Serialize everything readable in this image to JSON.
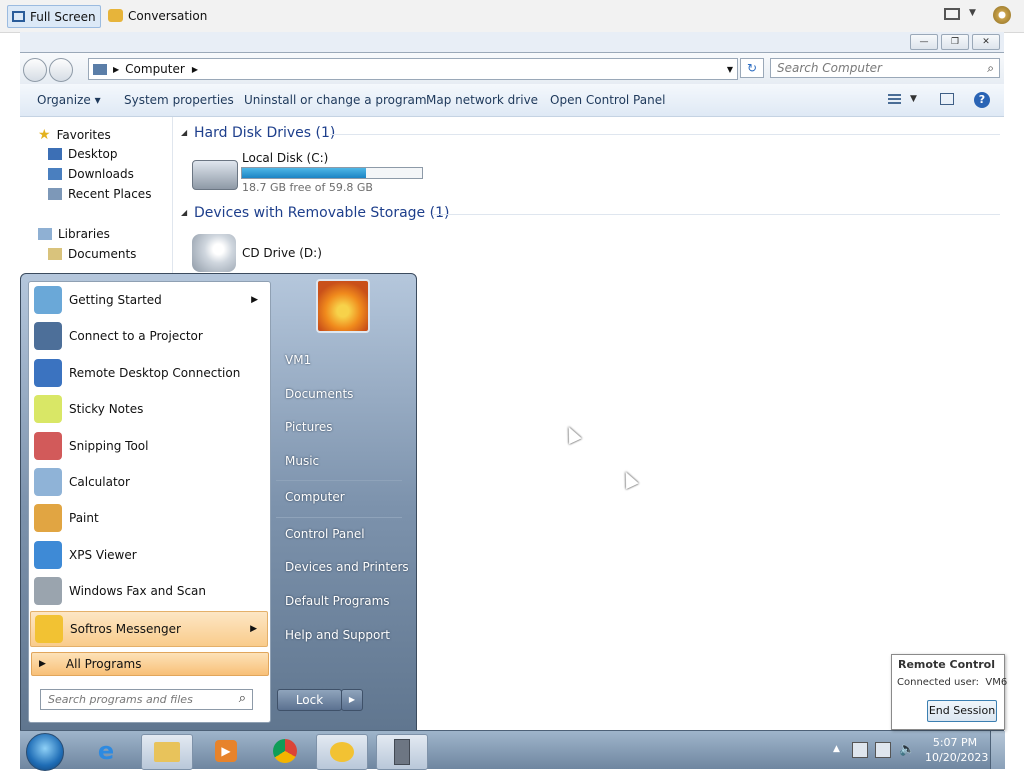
{
  "viewer": {
    "fullscreen_label": "Full Screen",
    "conversation_label": "Conversation"
  },
  "explorer": {
    "address_crumb": "Computer",
    "search_placeholder": "Search Computer",
    "commands": [
      "Organize",
      "System properties",
      "Uninstall or change a program",
      "Map network drive",
      "Open Control Panel"
    ],
    "nav_pane": {
      "favorites_label": "Favorites",
      "favorites": [
        "Desktop",
        "Downloads",
        "Recent Places"
      ],
      "libraries_label": "Libraries",
      "libraries": [
        "Documents"
      ]
    },
    "groups": {
      "hard_disk_header": "Hard Disk Drives (1)",
      "removable_header": "Devices with Removable Storage (1)"
    },
    "local_disk": {
      "name": "Local Disk (C:)",
      "free_text": "18.7 GB free of 59.8 GB",
      "used_fraction": 0.69
    },
    "cd_drive": {
      "name": "CD Drive (D:)"
    }
  },
  "start_menu": {
    "programs": [
      {
        "label": "Getting Started",
        "icon": "getting-started-icon",
        "submenu": true
      },
      {
        "label": "Connect to a Projector",
        "icon": "projector-icon",
        "submenu": false
      },
      {
        "label": "Remote Desktop Connection",
        "icon": "remote-desktop-icon",
        "submenu": false
      },
      {
        "label": "Sticky Notes",
        "icon": "sticky-notes-icon",
        "submenu": false
      },
      {
        "label": "Snipping Tool",
        "icon": "snipping-tool-icon",
        "submenu": false
      },
      {
        "label": "Calculator",
        "icon": "calculator-icon",
        "submenu": false
      },
      {
        "label": "Paint",
        "icon": "paint-icon",
        "submenu": false
      },
      {
        "label": "XPS Viewer",
        "icon": "xps-viewer-icon",
        "submenu": false
      },
      {
        "label": "Windows Fax and Scan",
        "icon": "fax-scan-icon",
        "submenu": false
      },
      {
        "label": "Softros Messenger",
        "icon": "softros-messenger-icon",
        "submenu": true
      }
    ],
    "all_programs_label": "All Programs",
    "search_placeholder": "Search programs and files",
    "right_items": [
      "VM1",
      "Documents",
      "Pictures",
      "Music",
      "Computer",
      "Control Panel",
      "Devices and Printers",
      "Default Programs",
      "Help and Support"
    ],
    "lock_label": "Lock"
  },
  "taskbar": {
    "apps": [
      "internet-explorer-icon",
      "windows-explorer-icon",
      "media-player-icon",
      "chrome-icon",
      "softros-messenger-icon",
      "server-icon"
    ],
    "time": "5:07 PM",
    "date": "10/20/2023"
  },
  "remote_control": {
    "title": "Remote Control",
    "connected_user": "Connected user:  VM6",
    "end_session_label": "End Session"
  }
}
